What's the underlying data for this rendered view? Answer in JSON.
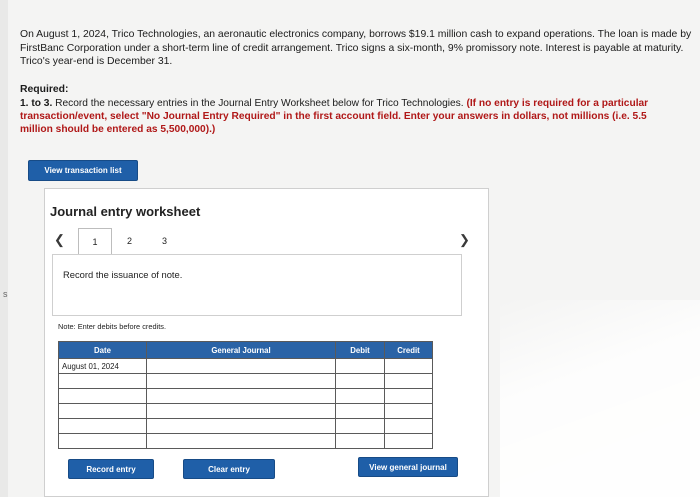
{
  "problem": {
    "text": "On August 1, 2024, Trico Technologies, an aeronautic electronics company, borrows $19.1 million cash to expand operations. The loan is made by FirstBanc Corporation under a short-term line of credit arrangement. Trico signs a six-month, 9% promissory note. Interest is payable at maturity. Trico's year-end is December 31."
  },
  "required": {
    "title": "Required:",
    "step_label": "1. to 3.",
    "instruction": "Record the necessary entries in the Journal Entry Worksheet below for Trico Technologies.",
    "warning": "(If no entry is required for a particular transaction/event, select \"No Journal Entry Required\" in the first account field. Enter your answers in dollars, not millions (i.e. 5.5 million should be entered as 5,500,000).)"
  },
  "buttons": {
    "view_transaction_list": "View transaction list",
    "record_entry": "Record entry",
    "clear_entry": "Clear entry",
    "view_general_journal": "View general journal"
  },
  "worksheet": {
    "title": "Journal entry worksheet",
    "tabs": [
      "1",
      "2",
      "3"
    ],
    "active_tab": "1",
    "instruction": "Record the issuance of note.",
    "note": "Note: Enter debits before credits."
  },
  "table": {
    "headers": {
      "date": "Date",
      "account": "General Journal",
      "debit": "Debit",
      "credit": "Credit"
    },
    "rows": [
      {
        "date": "August 01, 2024",
        "account": "",
        "debit": "",
        "credit": ""
      },
      {
        "date": "",
        "account": "",
        "debit": "",
        "credit": ""
      },
      {
        "date": "",
        "account": "",
        "debit": "",
        "credit": ""
      },
      {
        "date": "",
        "account": "",
        "debit": "",
        "credit": ""
      },
      {
        "date": "",
        "account": "",
        "debit": "",
        "credit": ""
      },
      {
        "date": "",
        "account": "",
        "debit": "",
        "credit": ""
      }
    ]
  },
  "icons": {
    "prev": "chevron-left-icon",
    "next": "chevron-right-icon"
  },
  "colors": {
    "button_blue": "#1f5fa8",
    "warning_red": "#b01818",
    "table_header": "#2a63a6"
  },
  "margin_mark": "s"
}
